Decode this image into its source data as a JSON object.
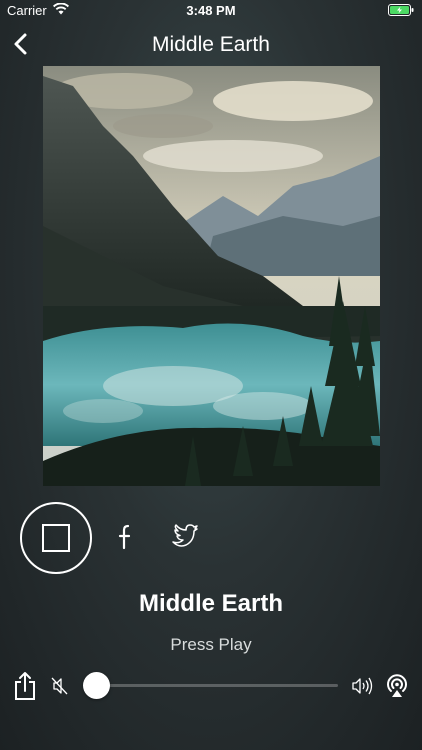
{
  "status_bar": {
    "carrier": "Carrier",
    "time": "3:48 PM"
  },
  "nav": {
    "title": "Middle Earth"
  },
  "track": {
    "title": "Middle Earth",
    "status": "Press Play"
  },
  "volume": {
    "level": 0.0
  },
  "icons": {
    "back": "chevron-left-icon",
    "stop": "stop-square-icon",
    "facebook": "facebook-icon",
    "twitter": "twitter-icon",
    "share": "share-icon",
    "volume_min": "speaker-mute-icon",
    "volume_max": "speaker-loud-icon",
    "airplay": "airplay-icon"
  },
  "colors": {
    "battery": "#4cd964",
    "accent": "#ffffff"
  }
}
